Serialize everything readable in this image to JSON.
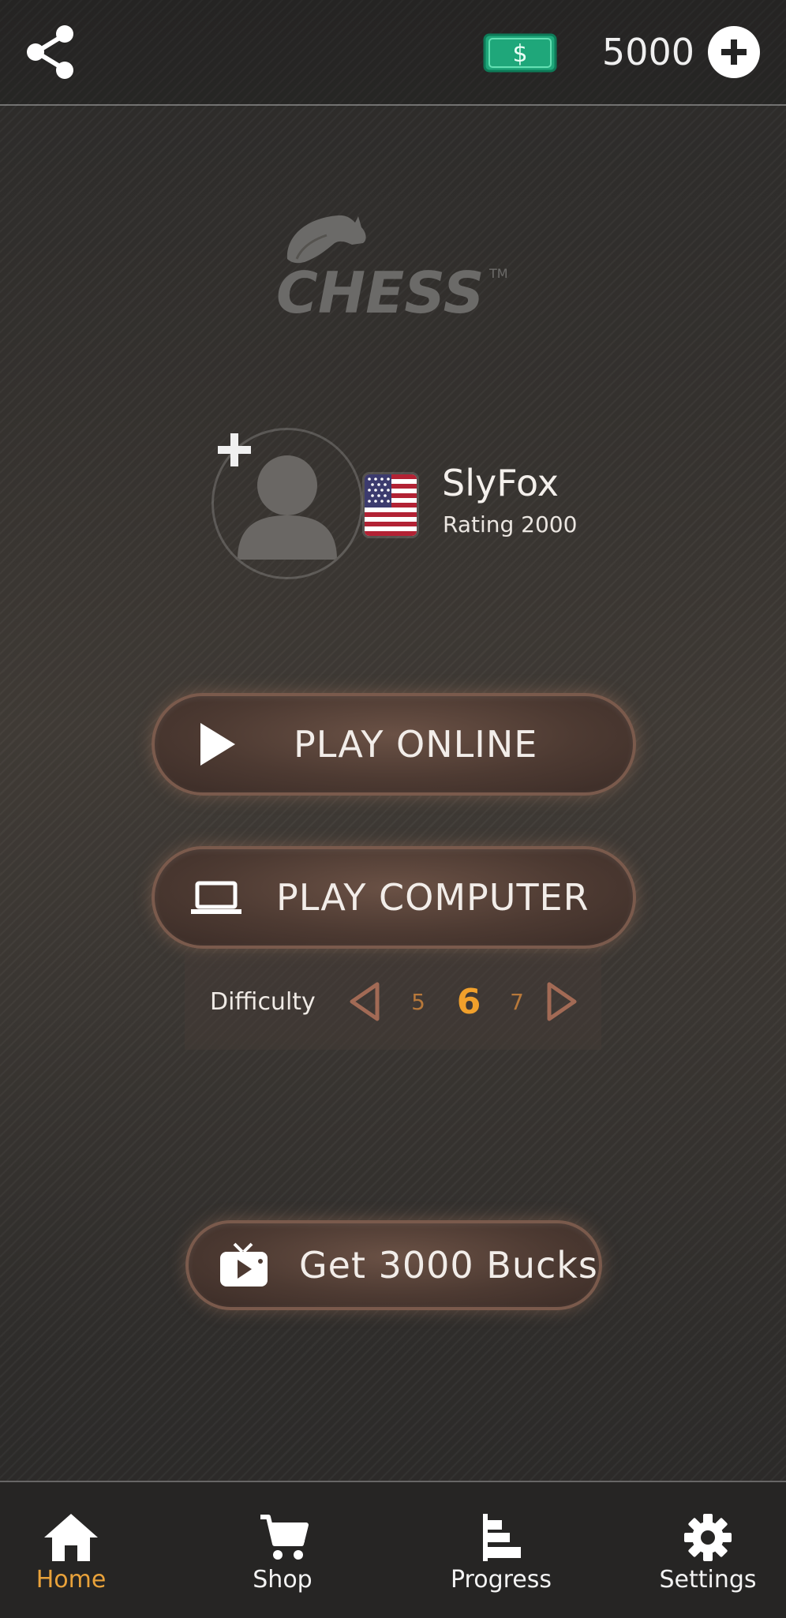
{
  "header": {
    "coins": "5000",
    "icons": {
      "share": "share-icon",
      "money": "dollar-bill-icon",
      "add": "plus-circle-icon"
    },
    "money_color": "#1fa77a"
  },
  "logo": {
    "text": "CHESS",
    "tm": "TM"
  },
  "profile": {
    "username": "SlyFox",
    "rating": "Rating 2000",
    "flag": "us-flag-icon"
  },
  "buttons": {
    "play_online": "PLAY ONLINE",
    "play_computer": "PLAY COMPUTER",
    "get_bucks": "Get 3000 Bucks"
  },
  "difficulty": {
    "label": "Difficulty",
    "prev": "5",
    "current": "6",
    "next": "7",
    "current_color": "#f1a02b"
  },
  "nav": {
    "items": [
      {
        "label": "Home",
        "icon": "home-icon",
        "active": true
      },
      {
        "label": "Shop",
        "icon": "cart-icon"
      },
      {
        "label": "Progress",
        "icon": "progress-bars-icon"
      },
      {
        "label": "Settings",
        "icon": "gear-icon"
      }
    ],
    "active_color": "#e9a23a"
  }
}
